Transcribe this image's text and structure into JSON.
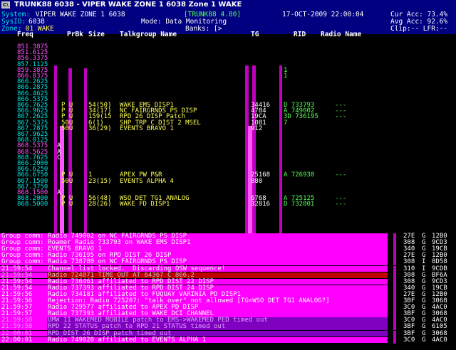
{
  "window": {
    "title": "TRUNK88  6038 - VIPER WAKE ZONE 1 6038   Zone 1 WAKE"
  },
  "header": {
    "system_label": "System:",
    "system_value": " VIPER WAKE ZONE 1 6038",
    "app_version": "[TRUNK88 4.80]",
    "datetime": "17-OCT-2009 22:00:04",
    "cur_acc": "Cur Acc: 73.4%",
    "sysid_label": "SysID:",
    "sysid_value": "6038",
    "mode": "Mode: Data Monitoring",
    "avg_acc": "Avg Acc: 92.6%",
    "zone_label": "Zone:",
    "zone_value": " 01 WAKE",
    "banks": "Banks: [>",
    "clip": "Clip:-- LFR:--"
  },
  "columns": {
    "freq": "Freq",
    "prbk": "PrBk",
    "size": "Size",
    "tg_name": "Talkgroup Name",
    "tg": "TG",
    "rid": "RID",
    "radio_name": "Radio Name"
  },
  "freqs": [
    {
      "f": "851.3875",
      "c": "#ff55ff",
      "flag": "",
      "pu": "",
      "size": "",
      "name": "",
      "tg": "",
      "rid": "",
      "extra": ""
    },
    {
      "f": "851.6125",
      "c": "#ff55ff",
      "flag": "",
      "pu": "",
      "size": "",
      "name": "",
      "tg": "",
      "rid": "",
      "extra": ""
    },
    {
      "f": "856.3375",
      "c": "#ff55ff",
      "flag": "",
      "pu": "",
      "size": "",
      "name": "",
      "tg": "",
      "rid": "",
      "extra": ""
    },
    {
      "f": "857.1125",
      "c": "#00e5e5",
      "flag": "",
      "pu": "",
      "size": "",
      "name": "",
      "tg": "",
      "rid": "",
      "extra": ""
    },
    {
      "f": "859.3875",
      "c": "#ff55ff",
      "flag": "",
      "pu": "",
      "size": "",
      "name": "",
      "tg": "",
      "rid": "1",
      "extra": ""
    },
    {
      "f": "866.0375",
      "c": "#ff55ff",
      "flag": "",
      "pu": "",
      "size": "",
      "name": "",
      "tg": "",
      "rid": "1",
      "extra": ""
    },
    {
      "f": "866.2625",
      "c": "#00e5e5",
      "flag": "",
      "pu": "",
      "size": "",
      "name": "",
      "tg": "",
      "rid": "",
      "extra": ""
    },
    {
      "f": "866.2875",
      "c": "#00e5e5",
      "flag": "",
      "pu": "",
      "size": "",
      "name": "",
      "tg": "",
      "rid": "",
      "extra": ""
    },
    {
      "f": "866.4625",
      "c": "#00e5e5",
      "flag": "",
      "pu": "",
      "size": "",
      "name": "",
      "tg": "",
      "rid": "",
      "extra": ""
    },
    {
      "f": "866.5375",
      "c": "#00e5e5",
      "flag": "",
      "pu": "",
      "size": "",
      "name": "",
      "tg": "",
      "rid": "",
      "extra": ""
    },
    {
      "f": "866.7625",
      "c": "#00e5e5",
      "flag": "",
      "pu": "P U",
      "size": "54(50)",
      "name": "WAKE EMS DISP1",
      "tg": "34416",
      "rid": "D 733793",
      "extra": "---"
    },
    {
      "f": "866.9625",
      "c": "#00e5e5",
      "flag": "",
      "pu": "P U",
      "size": "34(17)",
      "name": "NC FAIRGRNDS PS DISP",
      "tg": "4784",
      "rid": "A 749002",
      "extra": "---"
    },
    {
      "f": "867.2625",
      "c": "#00e5e5",
      "flag": "",
      "pu": "P U",
      "size": "159(15",
      "name": "RPD 26 DISP Patch",
      "tg": "19CA",
      "rid": "3D 736195",
      "extra": "---"
    },
    {
      "f": "867.5375",
      "c": "#00e5e5",
      "flag": "",
      "pu": "50U",
      "size": "6(1)",
      "name": "SHP TRP C DIST 2 MSEL",
      "tg": "1081",
      "rid": "7",
      "extra": ""
    },
    {
      "f": "867.7875",
      "c": "#00e5e5",
      "flag": "",
      "pu": "50U",
      "size": "36(29)",
      "name": "EVENTS BRAVO 1",
      "tg": "912",
      "rid": "",
      "extra": ""
    },
    {
      "f": "867.9625",
      "c": "#00e5e5",
      "flag": "",
      "pu": "",
      "size": "",
      "name": "",
      "tg": "",
      "rid": "",
      "extra": ""
    },
    {
      "f": "868.0125",
      "c": "#00e5e5",
      "flag": "",
      "pu": "",
      "size": "",
      "name": "",
      "tg": "",
      "rid": "",
      "extra": ""
    },
    {
      "f": "868.5375",
      "c": "#ff55ff",
      "flag": "A",
      "pu": "",
      "size": "",
      "name": "",
      "tg": "",
      "rid": "",
      "extra": ""
    },
    {
      "f": "868.5625",
      "c": "#ff55ff",
      "flag": "A",
      "pu": "",
      "size": "",
      "name": "",
      "tg": "",
      "rid": "",
      "extra": ""
    },
    {
      "f": "868.7625",
      "c": "#00e5e5",
      "flag": "C",
      "pu": "",
      "size": "",
      "name": "",
      "tg": "",
      "rid": "",
      "extra": ""
    },
    {
      "f": "866.2000",
      "c": "#00e5e5",
      "flag": "",
      "pu": "",
      "size": "",
      "name": "",
      "tg": "",
      "rid": "",
      "extra": ""
    },
    {
      "f": "866.6250",
      "c": "#00e5e5",
      "flag": "",
      "pu": "",
      "size": "",
      "name": "",
      "tg": "",
      "rid": "",
      "extra": ""
    },
    {
      "f": "866.6750",
      "c": "#00e5e5",
      "flag": "",
      "pu": "P U",
      "size": "1",
      "name": "APEX PW P&R",
      "tg": "25168",
      "rid": "A 726930",
      "extra": "---"
    },
    {
      "f": "867.1500",
      "c": "#00e5e5",
      "flag": "",
      "pu": "50U",
      "size": "23(15)",
      "name": "EVENTS ALPHA 4",
      "tg": "880",
      "rid": "",
      "extra": ""
    },
    {
      "f": "867.3750",
      "c": "#00e5e5",
      "flag": "",
      "pu": "",
      "size": "",
      "name": "",
      "tg": "",
      "rid": "",
      "extra": ""
    },
    {
      "f": "868.1500",
      "c": "#ff55ff",
      "flag": "A",
      "pu": "",
      "size": "",
      "name": "",
      "tg": "",
      "rid": "",
      "extra": ""
    },
    {
      "f": "868.2000",
      "c": "#00e5e5",
      "flag": "",
      "pu": "P U",
      "size": "56(48)",
      "name": "WSO DET TG1 ANALOG",
      "tg": "6768",
      "rid": "A 725125",
      "extra": "---"
    },
    {
      "f": "868.5000",
      "c": "#00e5e5",
      "flag": "",
      "pu": "P U",
      "size": "28(26)",
      "name": "WAKE FD DISP1",
      "tg": "32816",
      "rid": "D 732801",
      "extra": "---"
    }
  ],
  "log": [
    {
      "t": "Group comm: Radio 749002 on NC FAIRGRNDS PS DISP",
      "bg": "#ff00ff",
      "fg": "#ffffff"
    },
    {
      "t": "Group comm: Roamer Radio 733793 on WAKE EMS DISP1",
      "bg": "#ff00ff",
      "fg": "#ffffff"
    },
    {
      "t": "Group comm: EVENTS BRAVO 1",
      "bg": "#ff00ff",
      "fg": "#ffffff"
    },
    {
      "t": "Group comm: Radio 736195 on RPD DIST 26 DISP",
      "bg": "#ff00ff",
      "fg": "#ffffff"
    },
    {
      "t": "Group comm: Radio 738780 on NC FAIRGRNDS PS DISP",
      "bg": "#ff00ff",
      "fg": "#ffffff"
    },
    {
      "t": "21:59:54    Channel list locked.  Discarding OSW sequence!",
      "bg": "#ff00ff",
      "fg": "#ffffff"
    },
    {
      "t": "21:59:54    Radio 724871 TIME OUT AT 64367 C 866.2",
      "bg": "#c00000",
      "fg": "#c0c0c0"
    },
    {
      "t": "21:59:54    Radio 736461 affiliated to RPD DIST 22 DISP",
      "bg": "#ff00ff",
      "fg": "#ffffff"
    },
    {
      "t": "21:59:54    Radio 737393 affiliated to RPD DIST 24 DISP",
      "bg": "#ff00ff",
      "fg": "#ffffff"
    },
    {
      "t": "21:59:56    Radio 734181 affiliated to FUQUAY VARINIA PD DISP1",
      "bg": "#ff00ff",
      "fg": "#ffffff"
    },
    {
      "t": "21:59:56    Rejection: Radio 725207: \"talk over\" not allowed [TG=WSO DET TG1 ANALOG?]",
      "bg": "#ff00ff",
      "fg": "#ffffff"
    },
    {
      "t": "21:59:57    Radio 729577 affiliated to APEX PD DISP",
      "bg": "#ff00ff",
      "fg": "#ffffff"
    },
    {
      "t": "21:59:57    Radio 737393 affiliated to WAKE DCI CHANNEL",
      "bg": "#ff00ff",
      "fg": "#ffffff"
    },
    {
      "t": "21:59:58    UMW 11 WAKEMED MOBILE patch to EMS->WAKEMED PED timed out",
      "bg": "#8000c0",
      "fg": "#e0a0ff"
    },
    {
      "t": "21:59:58    RPD 22 STATUS patch to RPD 21 STATUS timed out",
      "bg": "#8000c0",
      "fg": "#e0a0ff"
    },
    {
      "t": "22:00:01    RPD DIST 26 DISP patch timed out",
      "bg": "#8000c0",
      "fg": "#e0a0ff"
    },
    {
      "t": "22:00:01    Radio 749020 affiliated to EVENTS ALPHA 1",
      "bg": "#ff00ff",
      "fg": "#ffffff"
    }
  ],
  "side": [
    {
      "a": "27E",
      "b": "G",
      "c": "12B0"
    },
    {
      "a": "308",
      "b": "G",
      "c": "9CD3"
    },
    {
      "a": "340",
      "b": "G",
      "c": "19CB"
    },
    {
      "a": "27E",
      "b": "G",
      "c": "12B0"
    },
    {
      "a": "308",
      "b": "I",
      "c": "8D58"
    },
    {
      "a": "310",
      "b": "I",
      "c": "9CDB"
    },
    {
      "a": "308",
      "b": "G",
      "c": "BF6A"
    },
    {
      "a": "308",
      "b": "G",
      "c": "9CD3"
    },
    {
      "a": "340",
      "b": "G",
      "c": "19CB"
    },
    {
      "a": "27E",
      "b": "G",
      "c": "12B0"
    },
    {
      "a": "3BF",
      "b": "G",
      "c": "3068"
    },
    {
      "a": "3C0",
      "b": "G",
      "c": "4AC0"
    },
    {
      "a": "3BF",
      "b": "G",
      "c": "3068"
    },
    {
      "a": "3C0",
      "b": "G",
      "c": "4AC0"
    },
    {
      "a": "3BF",
      "b": "G",
      "c": "6105"
    },
    {
      "a": "3BF",
      "b": "G",
      "c": "3068"
    },
    {
      "a": "3C0",
      "b": "G",
      "c": "4AC0"
    }
  ]
}
